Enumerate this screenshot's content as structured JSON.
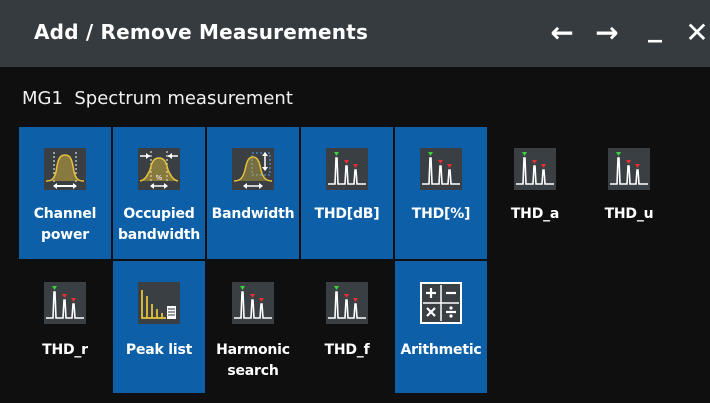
{
  "window": {
    "title": "Add / Remove Measurements",
    "controls": {
      "back": "←",
      "forward": "→",
      "minimize": "_",
      "close": "✕"
    }
  },
  "group": {
    "label": "MG1  Spectrum measurement"
  },
  "tiles": [
    {
      "label": "Channel power",
      "selected": true,
      "icon": "channel-power-icon"
    },
    {
      "label": "Occupied bandwidth",
      "selected": true,
      "icon": "occupied-bandwidth-icon"
    },
    {
      "label": "Bandwidth",
      "selected": true,
      "icon": "bandwidth-icon"
    },
    {
      "label": "THD[dB]",
      "selected": true,
      "icon": "harmonics-icon"
    },
    {
      "label": "THD[%]",
      "selected": true,
      "icon": "harmonics-icon"
    },
    {
      "label": "THD_a",
      "selected": false,
      "icon": "harmonics-icon"
    },
    {
      "label": "THD_u",
      "selected": false,
      "icon": "harmonics-icon"
    },
    {
      "label": "THD_r",
      "selected": false,
      "icon": "harmonics-icon"
    },
    {
      "label": "Peak list",
      "selected": true,
      "icon": "peak-list-icon"
    },
    {
      "label": "Harmonic search",
      "selected": false,
      "icon": "harmonics-icon"
    },
    {
      "label": "THD_f",
      "selected": false,
      "icon": "harmonics-icon"
    },
    {
      "label": "Arithmetic",
      "selected": true,
      "icon": "arithmetic-icon"
    }
  ],
  "colors": {
    "selected": "#0d60a8",
    "titlebar": "#363b40",
    "background": "#0f0f0f",
    "trace": "#e8c23a"
  }
}
